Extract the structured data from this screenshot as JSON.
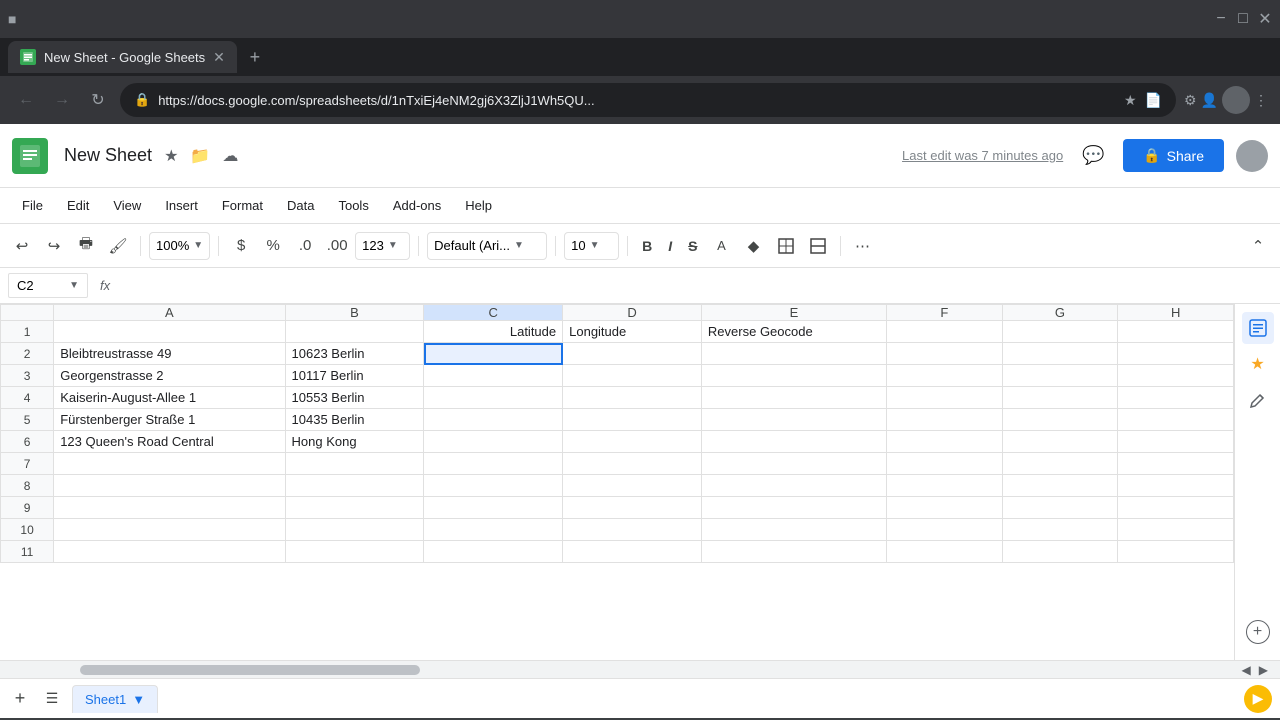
{
  "browser": {
    "tab_title": "New Sheet - Google Sheets",
    "url": "https://docs.google.com/spreadsheets/d/1nTxiEj4eNM2gj6X3ZljJ1Wh5QU...",
    "favicon_text": "G"
  },
  "header": {
    "doc_title": "New Sheet",
    "last_edit": "Last edit was 7 minutes ago",
    "share_label": "Share"
  },
  "menu": {
    "items": [
      "File",
      "Edit",
      "View",
      "Insert",
      "Format",
      "Data",
      "Tools",
      "Add-ons",
      "Help"
    ]
  },
  "toolbar": {
    "zoom": "100%",
    "font": "Default (Ari...",
    "font_size": "10",
    "currency": "$",
    "percent": "%",
    "decimal1": ".0",
    "decimal2": ".00",
    "format123": "123"
  },
  "formula_bar": {
    "cell_ref": "C2",
    "formula_label": "fx"
  },
  "grid": {
    "columns": [
      "",
      "A",
      "B",
      "C",
      "D",
      "E",
      "F",
      "G",
      "H"
    ],
    "rows": [
      {
        "num": "1",
        "a": "",
        "b": "",
        "c": "Latitude",
        "d": "Longitude",
        "e": "Reverse Geocode",
        "f": "",
        "g": "",
        "h": ""
      },
      {
        "num": "2",
        "a": "Bleibtreustrasse 49",
        "b": "10623 Berlin",
        "c": "",
        "d": "",
        "e": "",
        "f": "",
        "g": "",
        "h": ""
      },
      {
        "num": "3",
        "a": "Georgenstrasse 2",
        "b": "10117 Berlin",
        "c": "",
        "d": "",
        "e": "",
        "f": "",
        "g": "",
        "h": ""
      },
      {
        "num": "4",
        "a": "Kaiserin-August-Allee 1",
        "b": "10553 Berlin",
        "c": "",
        "d": "",
        "e": "",
        "f": "",
        "g": "",
        "h": ""
      },
      {
        "num": "5",
        "a": "Fürstenberger Straße 1",
        "b": "10435 Berlin",
        "c": "",
        "d": "",
        "e": "",
        "f": "",
        "g": "",
        "h": ""
      },
      {
        "num": "6",
        "a": "123 Queen's Road Central",
        "b": "Hong Kong",
        "c": "",
        "d": "",
        "e": "",
        "f": "",
        "g": "",
        "h": ""
      },
      {
        "num": "7",
        "a": "",
        "b": "",
        "c": "",
        "d": "",
        "e": "",
        "f": "",
        "g": "",
        "h": ""
      },
      {
        "num": "8",
        "a": "",
        "b": "",
        "c": "",
        "d": "",
        "e": "",
        "f": "",
        "g": "",
        "h": ""
      },
      {
        "num": "9",
        "a": "",
        "b": "",
        "c": "",
        "d": "",
        "e": "",
        "f": "",
        "g": "",
        "h": ""
      },
      {
        "num": "10",
        "a": "",
        "b": "",
        "c": "",
        "d": "",
        "e": "",
        "f": "",
        "g": "",
        "h": ""
      },
      {
        "num": "11",
        "a": "",
        "b": "",
        "c": "",
        "d": "",
        "e": "",
        "f": "",
        "g": "",
        "h": ""
      }
    ]
  },
  "sheet_tabs": {
    "active": "Sheet1",
    "items": [
      "Sheet1"
    ]
  },
  "right_panel": {
    "icons": [
      "grid",
      "star",
      "pen",
      "plus"
    ]
  }
}
